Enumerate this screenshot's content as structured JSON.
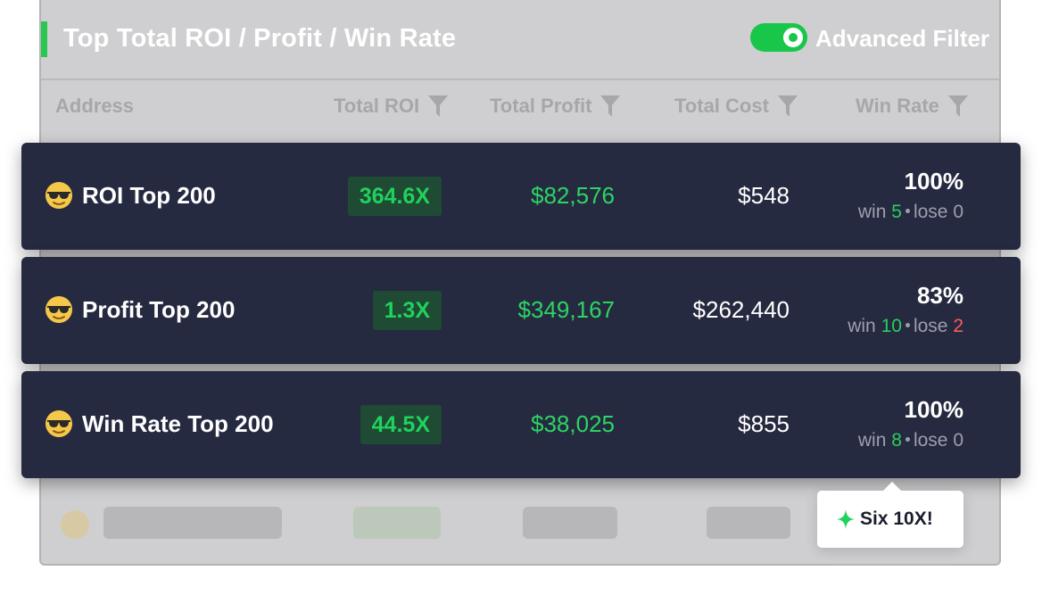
{
  "header": {
    "title": "Top Total ROI / Profit / Win Rate",
    "filter_toggle_label": "Advanced Filter",
    "filter_toggle_on": true
  },
  "columns": {
    "address": "Address",
    "total_roi": "Total ROI",
    "total_profit": "Total Profit",
    "total_cost": "Total Cost",
    "win_rate": "Win Rate"
  },
  "rows": [
    {
      "name": "ROI Top 200",
      "roi": "364.6X",
      "profit": "$82,576",
      "cost": "$548",
      "win_rate": "100%",
      "win_label": "win",
      "win": "5",
      "lose_label": "lose",
      "lose": "0"
    },
    {
      "name": "Profit Top 200",
      "roi": "1.3X",
      "profit": "$349,167",
      "cost": "$262,440",
      "win_rate": "83%",
      "win_label": "win",
      "win": "10",
      "lose_label": "lose",
      "lose": "2"
    },
    {
      "name": "Win Rate Top 200",
      "roi": "44.5X",
      "profit": "$38,025",
      "cost": "$855",
      "win_rate": "100%",
      "win_label": "win",
      "win": "8",
      "lose_label": "lose",
      "lose": "0"
    }
  ],
  "tooltip": {
    "text": "Six 10X!"
  },
  "icons": {
    "row_icon": "sunglasses-emoji-icon",
    "filter": "funnel-icon",
    "tooltip": "sparkle-icon"
  },
  "colors": {
    "accent": "#27c750",
    "green": "#2bd563",
    "red": "#ff5a5a",
    "row_bg": "#262a40"
  }
}
